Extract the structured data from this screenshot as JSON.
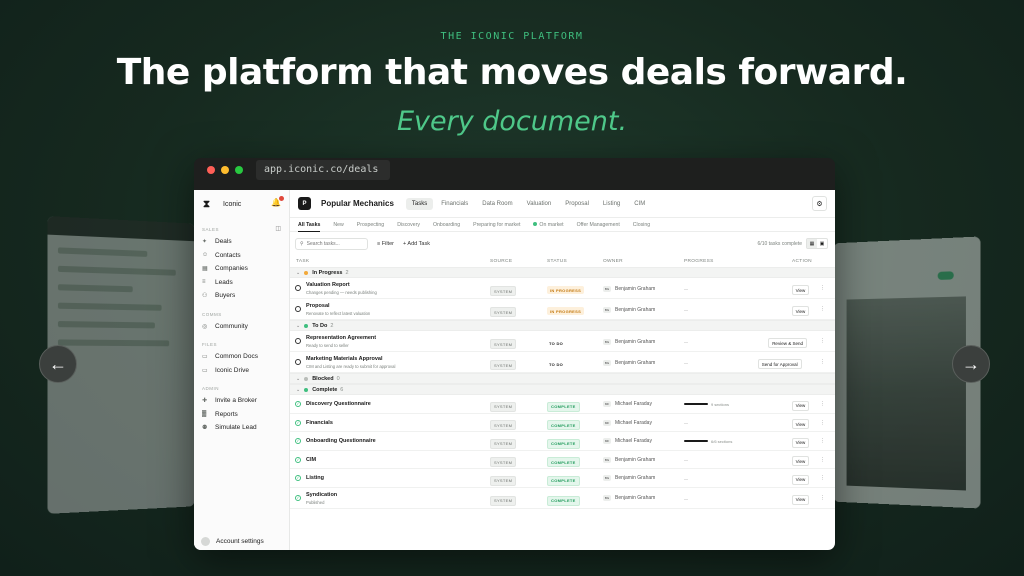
{
  "hero": {
    "eyebrow": "THE ICONIC PLATFORM",
    "headline": "The platform that moves deals forward.",
    "subhead": "Every document."
  },
  "colors": {
    "accent": "#3fbf7f",
    "background": "#16291f",
    "in_progress": "#c47a12",
    "complete": "#1e9a5a"
  },
  "browser": {
    "url": "app.iconic.co/deals"
  },
  "sidebar": {
    "brand": "Iconic",
    "sections": [
      {
        "label": "SALES",
        "items": [
          {
            "label": "Deals",
            "icon": "handshake-icon"
          },
          {
            "label": "Contacts",
            "icon": "contacts-icon"
          },
          {
            "label": "Companies",
            "icon": "building-icon"
          },
          {
            "label": "Leads",
            "icon": "leads-icon"
          },
          {
            "label": "Buyers",
            "icon": "buyers-icon"
          }
        ]
      },
      {
        "label": "COMMS",
        "items": [
          {
            "label": "Community",
            "icon": "globe-icon"
          }
        ]
      },
      {
        "label": "FILES",
        "items": [
          {
            "label": "Common Docs",
            "icon": "chat-icon"
          },
          {
            "label": "Iconic Drive",
            "icon": "drive-icon"
          }
        ]
      },
      {
        "label": "ADMIN",
        "items": [
          {
            "label": "Invite a Broker",
            "icon": "user-plus-icon"
          },
          {
            "label": "Reports",
            "icon": "chart-icon"
          },
          {
            "label": "Simulate Lead",
            "icon": "person-icon"
          }
        ]
      }
    ],
    "account": "Account settings"
  },
  "topbar": {
    "deal_initial": "P",
    "deal_name": "Popular Mechanics",
    "tabs": [
      "Tasks",
      "Financials",
      "Data Room",
      "Valuation",
      "Proposal",
      "Listing",
      "CIM"
    ],
    "active_tab": "Tasks"
  },
  "stages": [
    "All Tasks",
    "New",
    "Prospecting",
    "Discovery",
    "Onboarding",
    "Preparing for market",
    "On market",
    "Offer Management",
    "Closing"
  ],
  "toolbar": {
    "search_placeholder": "Search tasks...",
    "filter": "Filter",
    "add_task": "+ Add Task",
    "count": "6/10 tasks complete"
  },
  "table": {
    "headers": [
      "TASK",
      "SOURCE",
      "STATUS",
      "OWNER",
      "PROGRESS",
      "ACTION"
    ],
    "groups": [
      {
        "name": "In Progress",
        "count": "2",
        "dot": "#f2a93b",
        "tasks": [
          {
            "name": "Valuation Report",
            "sub": "Changes pending — needs publishing",
            "source": "SYSTEM",
            "status": "IN PROGRESS",
            "owner_initials": "BG",
            "owner": "Benjamin Graham",
            "progress": "—",
            "action": "View"
          },
          {
            "name": "Proposal",
            "sub": "Renovate to reflect latest valuation",
            "source": "SYSTEM",
            "status": "IN PROGRESS",
            "owner_initials": "BG",
            "owner": "Benjamin Graham",
            "progress": "—",
            "action": "View"
          }
        ]
      },
      {
        "name": "To Do",
        "count": "2",
        "dot": "#3fbf7f",
        "tasks": [
          {
            "name": "Representation Agreement",
            "sub": "Ready to send to seller",
            "source": "SYSTEM",
            "status": "TO DO",
            "owner_initials": "BG",
            "owner": "Benjamin Graham",
            "progress": "—",
            "action": "Review & Send"
          },
          {
            "name": "Marketing Materials Approval",
            "sub": "CIM and Listing are ready to submit for approval",
            "source": "SYSTEM",
            "status": "TO DO",
            "owner_initials": "BG",
            "owner": "Benjamin Graham",
            "progress": "—",
            "action": "Send for Approval"
          }
        ]
      },
      {
        "name": "Blocked",
        "count": "0",
        "dot": "#b9bdb9",
        "tasks": []
      },
      {
        "name": "Complete",
        "count": "6",
        "dot": "#3fbf7f",
        "tasks": [
          {
            "name": "Discovery Questionnaire",
            "sub": "",
            "source": "SYSTEM",
            "status": "COMPLETE",
            "owner_initials": "MF",
            "owner": "Michael Faraday",
            "progress": "9 sections",
            "action": "View"
          },
          {
            "name": "Financials",
            "sub": "",
            "source": "SYSTEM",
            "status": "COMPLETE",
            "owner_initials": "MF",
            "owner": "Michael Faraday",
            "progress": "—",
            "action": "View"
          },
          {
            "name": "Onboarding Questionnaire",
            "sub": "",
            "source": "SYSTEM",
            "status": "COMPLETE",
            "owner_initials": "MF",
            "owner": "Michael Faraday",
            "progress": "6/6 sections",
            "action": "View"
          },
          {
            "name": "CIM",
            "sub": "",
            "source": "SYSTEM",
            "status": "COMPLETE",
            "owner_initials": "BG",
            "owner": "Benjamin Graham",
            "progress": "—",
            "action": "View"
          },
          {
            "name": "Listing",
            "sub": "",
            "source": "SYSTEM",
            "status": "COMPLETE",
            "owner_initials": "BG",
            "owner": "Benjamin Graham",
            "progress": "—",
            "action": "View"
          },
          {
            "name": "Syndication",
            "sub": "Published",
            "source": "SYSTEM",
            "status": "COMPLETE",
            "owner_initials": "BG",
            "owner": "Benjamin Graham",
            "progress": "—",
            "action": "View"
          }
        ]
      }
    ]
  }
}
